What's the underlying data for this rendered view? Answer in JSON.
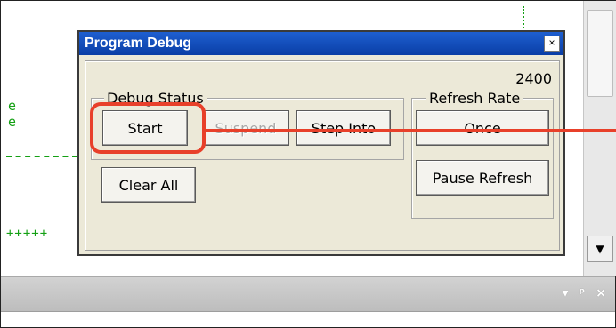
{
  "dialog": {
    "title": "Program Debug",
    "close_glyph": "×",
    "counter": "2400",
    "debug_status": {
      "label": "Debug Status",
      "start": "Start",
      "suspend": "Suspend",
      "step_into": "Step Into",
      "clear_all": "Clear All"
    },
    "refresh_rate": {
      "label": "Refresh Rate",
      "once": "Once",
      "pause_refresh": "Pause Refresh"
    }
  },
  "background": {
    "lines": [
      "e",
      "e"
    ],
    "plus_line": "+++++"
  },
  "panel": {
    "controls": [
      "▾",
      "ᵖ",
      "×"
    ]
  },
  "icons": {
    "close": "close-icon",
    "scroll_down": "chevron-down-icon",
    "panel_menu": "chevron-down-icon",
    "panel_pin": "pin-icon",
    "panel_close": "close-icon"
  },
  "colors": {
    "highlight": "#e8402a",
    "titlebar": "#0a3ea6",
    "code_text": "#14a014"
  }
}
